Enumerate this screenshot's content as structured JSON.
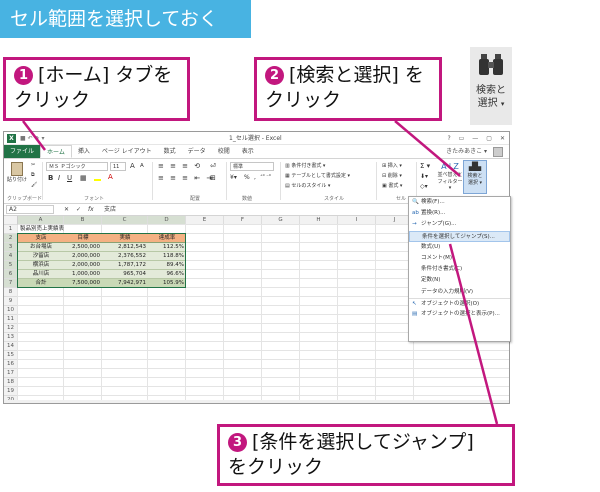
{
  "title": "セル範囲を選択しておく",
  "callouts": {
    "c1": {
      "num": "1",
      "line1": "[ホーム] タブを",
      "line2": "クリック"
    },
    "c2": {
      "num": "2",
      "line1": "[検索と選択] を",
      "line2": "クリック"
    },
    "c3": {
      "num": "3",
      "line1": "[条件を選択してジャンプ]",
      "line2": "をクリック"
    }
  },
  "big_button": {
    "line1": "検索と",
    "line2": "選択",
    "arrow": "▾",
    "icon": "binoculars-icon"
  },
  "colors": {
    "accent_band": "#48b3e2",
    "callout": "#c2177e",
    "excel_green": "#217346",
    "header_fill": "#f4b183",
    "total_fill": "#c9d9b6"
  },
  "excel": {
    "window_title": "1_セル選択 - Excel",
    "window_buttons": [
      "?",
      "▭",
      "—",
      "▢",
      "✕"
    ],
    "user": "きたみあきこ ▾",
    "tabs": [
      "ファイル",
      "ホーム",
      "挿入",
      "ページ レイアウト",
      "数式",
      "データ",
      "校閲",
      "表示"
    ],
    "ribbon": {
      "clipboard": {
        "paste": "貼り付け",
        "label": "クリップボード"
      },
      "font": {
        "name": "ＭＳ Ｐゴシック",
        "size": "11",
        "bold": "B",
        "italic": "I",
        "underline": "U",
        "grow": "A",
        "shrink": "A",
        "label": "フォント"
      },
      "alignment": {
        "label": "配置"
      },
      "number": {
        "format": "標準",
        "percent": "%",
        "comma": ",",
        "label": "数値"
      },
      "styles": {
        "conditional": "条件付き書式 ▾",
        "table": "テーブルとして書式設定 ▾",
        "cell": "セルのスタイル ▾",
        "label": "スタイル"
      },
      "cells": {
        "insert": "挿入 ▾",
        "delete": "削除 ▾",
        "format": "書式 ▾",
        "label": "セル"
      },
      "editing": {
        "sigma": "Σ ▾",
        "sort": "並べ替えと",
        "filter": "フィルター ▾",
        "find": "検索と",
        "select": "選択 ▾"
      }
    },
    "formula_bar": {
      "cell_ref": "A2",
      "fx": "fx",
      "content": "支店"
    },
    "columns": [
      "A",
      "B",
      "C",
      "D",
      "E",
      "F",
      "G",
      "H",
      "I",
      "J"
    ],
    "rows": [
      "1",
      "2",
      "3",
      "4",
      "5",
      "6",
      "7",
      "8",
      "9",
      "10",
      "11",
      "12",
      "13",
      "14",
      "15",
      "16",
      "17",
      "18",
      "19",
      "20",
      "21",
      "22",
      "23"
    ],
    "sheet": {
      "title": "製品別売上実績表",
      "headers": [
        "支店",
        "目標",
        "実績",
        "達成率"
      ],
      "data": [
        [
          "お台場店",
          "2,500,000",
          "2,812,543",
          "112.5%"
        ],
        [
          "汐留店",
          "2,000,000",
          "2,376,552",
          "118.8%"
        ],
        [
          "横浜店",
          "2,000,000",
          "1,787,172",
          "89.4%"
        ],
        [
          "品川店",
          "1,000,000",
          "965,704",
          "96.6%"
        ]
      ],
      "total": [
        "合計",
        "7,500,000",
        "7,942,971",
        "105.9%"
      ]
    },
    "menu": [
      {
        "icon": "binoculars-icon",
        "glyph": "🔍",
        "label": "検索(F)..."
      },
      {
        "icon": "replace-icon",
        "glyph": "ab",
        "label": "置換(R)..."
      },
      {
        "icon": "arrow-right-icon",
        "glyph": "→",
        "label": "ジャンプ(G)..."
      },
      {
        "icon": "",
        "glyph": "",
        "label": "条件を選択してジャンプ(S)..."
      },
      {
        "icon": "",
        "glyph": "",
        "label": "数式(U)"
      },
      {
        "icon": "",
        "glyph": "",
        "label": "コメント(M)"
      },
      {
        "icon": "",
        "glyph": "",
        "label": "条件付き書式(C)"
      },
      {
        "icon": "",
        "glyph": "",
        "label": "定数(N)"
      },
      {
        "icon": "",
        "glyph": "",
        "label": "データの入力規則(V)"
      },
      {
        "icon": "cursor-icon",
        "glyph": "↖",
        "label": "オブジェクトの選択(O)"
      },
      {
        "icon": "selection-pane-icon",
        "glyph": "▤",
        "label": "オブジェクトの選択と表示(P)..."
      }
    ]
  }
}
